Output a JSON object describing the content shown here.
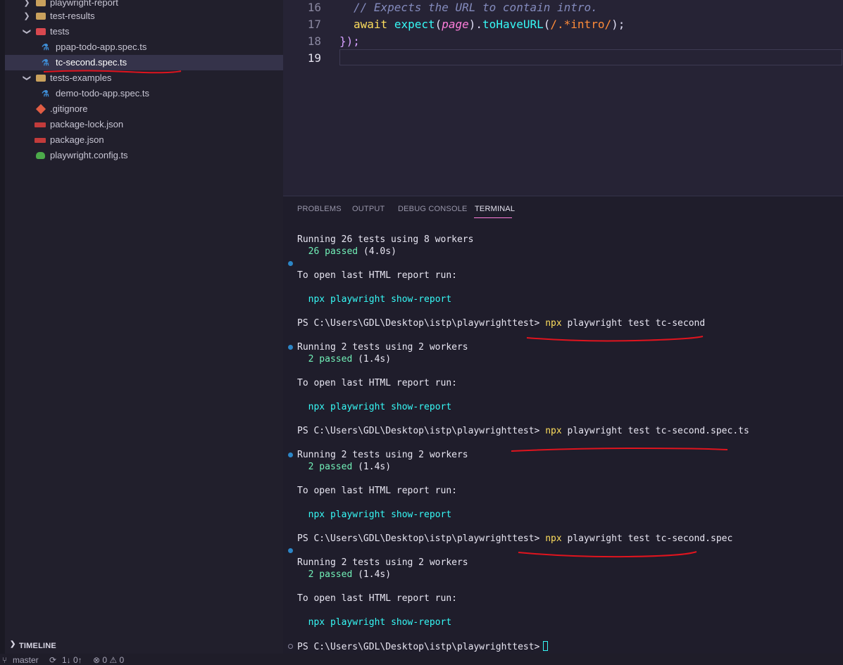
{
  "sidebar": {
    "items": [
      {
        "label": "playwright-report",
        "kind": "folder",
        "expanded": false
      },
      {
        "label": "test-results",
        "kind": "folder",
        "expanded": false
      },
      {
        "label": "tests",
        "kind": "folder",
        "expanded": true
      },
      {
        "label": "ppap-todo-app.spec.ts",
        "kind": "ts-file"
      },
      {
        "label": "tc-second.spec.ts",
        "kind": "ts-file",
        "selected": true
      },
      {
        "label": "tests-examples",
        "kind": "folder",
        "expanded": true
      },
      {
        "label": "demo-todo-app.spec.ts",
        "kind": "ts-file"
      },
      {
        "label": ".gitignore",
        "kind": "git-file"
      },
      {
        "label": "package-lock.json",
        "kind": "npm-file"
      },
      {
        "label": "package.json",
        "kind": "npm-file"
      },
      {
        "label": "playwright.config.ts",
        "kind": "config-file"
      }
    ],
    "timeline_label": "TIMELINE"
  },
  "statusbar": {
    "branch": "master",
    "sync": "1↓ 0↑",
    "problems": "⊗ 0 ⚠ 0"
  },
  "editor": {
    "lines": [
      {
        "number": "16",
        "comment": "// Expects the URL to contain intro."
      },
      {
        "number": "17",
        "kw": "await",
        "fn": "expect",
        "p1": "(",
        "var": "page",
        "p2": ").",
        "method": "toHaveURL",
        "p3": "(",
        "regex": "/.*intro/",
        "p4": ");"
      },
      {
        "number": "18",
        "brace": "});"
      },
      {
        "number": "19"
      }
    ]
  },
  "panel": {
    "tabs": [
      "PROBLEMS",
      "OUTPUT",
      "DEBUG CONSOLE",
      "TERMINAL"
    ],
    "active_tab": "TERMINAL",
    "terminal": {
      "run1_header": "Running 26 tests using 8 workers",
      "run1_passed": "26 passed",
      "run1_time": " (4.0s)",
      "open_report": "To open last HTML report run:",
      "npx": "npx",
      "playwright": "playwright",
      "show_report": "show-report",
      "prompt": "PS C:\\Users\\GDL\\Desktop\\istp\\playwrighttest>",
      "cmd1_rest": " playwright test tc-second",
      "cmd2_rest": " playwright test tc-second.spec.ts",
      "cmd3_rest": " playwright test tc-second.spec",
      "run2_header": "Running 2 tests using 2 workers",
      "run2_passed": "2 passed",
      "run2_time": " (1.4s)"
    }
  },
  "colors": {
    "annotation_underline": "#e0141e",
    "accent_tab": "#ff7edb"
  }
}
